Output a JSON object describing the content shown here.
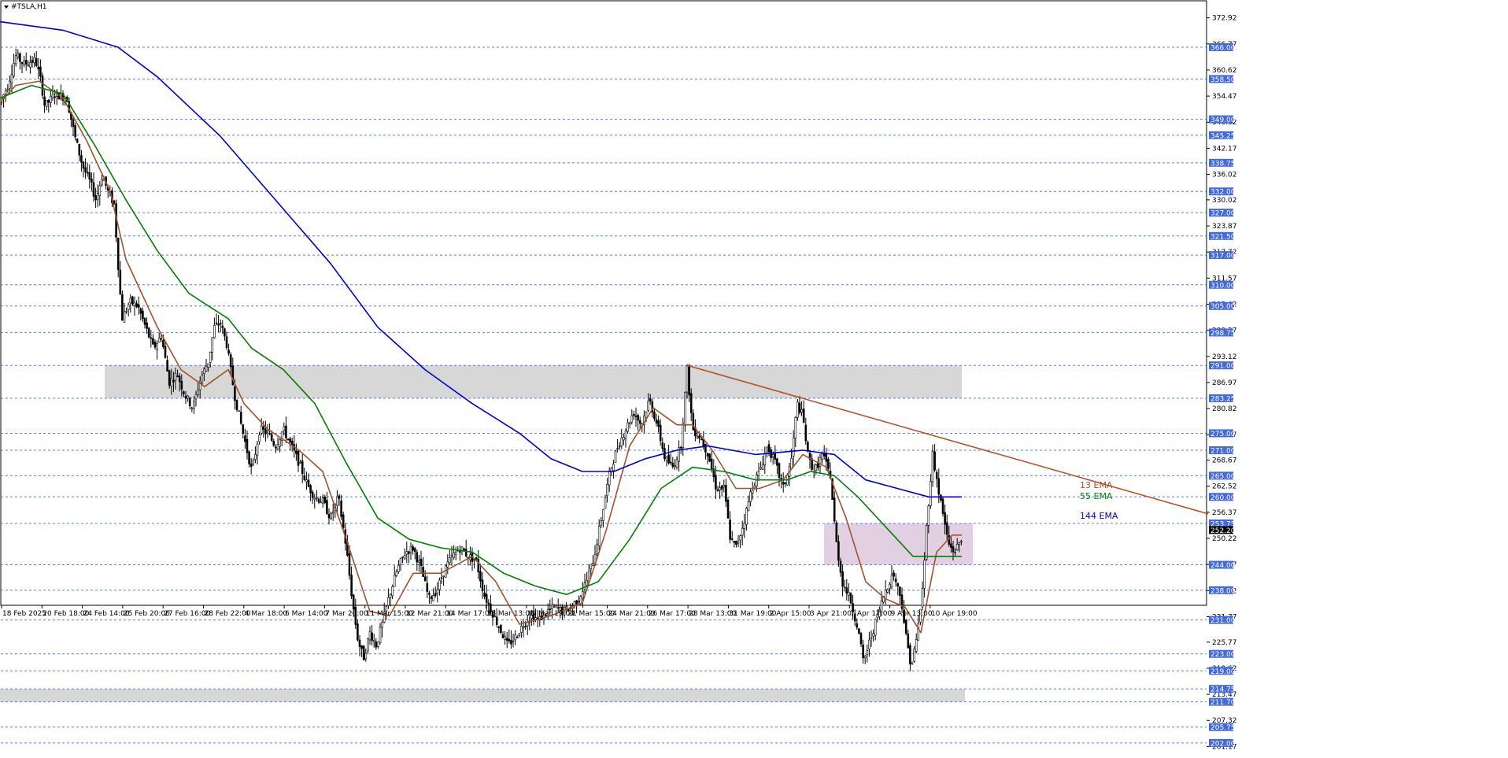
{
  "window": {
    "symbol_title": "#TSLA,H1"
  },
  "colors": {
    "ema13": "#a0522d",
    "ema55": "#008000",
    "ema144": "#0000cd",
    "trendline": "#b5562a",
    "resistance_zone": "#d3d3d3",
    "current_zone": "#d8bfd8",
    "grid_dash": "#4169e1",
    "level_label_bg": "#4169e1",
    "price_label_bg": "#000000",
    "candle": "#000000"
  },
  "chart_data": {
    "type": "candlestick",
    "symbol": "#TSLA",
    "timeframe": "H1",
    "ylim": [
      200.55,
      374.6
    ],
    "y_ticks": [
      "372.92",
      "366.77",
      "360.62",
      "354.47",
      "348.32",
      "342.17",
      "336.02",
      "330.02",
      "323.87",
      "317.72",
      "311.57",
      "305.42",
      "299.27",
      "293.12",
      "286.97",
      "280.82",
      "274.67",
      "268.67",
      "262.52",
      "256.37",
      "250.22",
      "244.07",
      "237.92",
      "231.77",
      "225.77",
      "219.62",
      "213.47",
      "207.32",
      "201.17"
    ],
    "horizontal_levels": [
      366.0,
      358.5,
      349.0,
      345.25,
      338.75,
      332.0,
      327.0,
      321.5,
      317.0,
      310.0,
      305.0,
      298.75,
      291.0,
      283.25,
      275.0,
      271.0,
      265.0,
      260.0,
      253.75,
      244.0,
      238.0,
      231.0,
      223.0,
      219.0,
      214.75,
      211.7,
      205.75,
      202.0
    ],
    "current_price": "252.20",
    "x_axis_labels": [
      "18 Feb 2025",
      "20 Feb 18:00",
      "24 Feb 14:00",
      "25 Feb 20:00",
      "27 Feb 16:00",
      "28 Feb 22:00",
      "4 Mar 18:00",
      "6 Mar 14:00",
      "7 Mar 20:00",
      "11 Mar 15:00",
      "12 Mar 21:00",
      "14 Mar 17:00",
      "18 Mar 13:00",
      "19 Mar 19:00",
      "21 Mar 15:00",
      "24 Mar 21:00",
      "26 Mar 17:00",
      "28 Mar 13:00",
      "31 Mar 19:00",
      "2 Apr 15:00",
      "3 Apr 21:00",
      "7 Apr 17:00",
      "9 Apr 13:00",
      "10 Apr 19:00"
    ],
    "price_path": [
      [
        0,
        353
      ],
      [
        10,
        357
      ],
      [
        20,
        364
      ],
      [
        30,
        362
      ],
      [
        45,
        363
      ],
      [
        52,
        358
      ],
      [
        57,
        352
      ],
      [
        70,
        355
      ],
      [
        85,
        354
      ],
      [
        95,
        345
      ],
      [
        105,
        338
      ],
      [
        115,
        334
      ],
      [
        122,
        330
      ],
      [
        130,
        336
      ],
      [
        137,
        332
      ],
      [
        145,
        329
      ],
      [
        150,
        315
      ],
      [
        155,
        302
      ],
      [
        165,
        306
      ],
      [
        175,
        305
      ],
      [
        185,
        300
      ],
      [
        195,
        295
      ],
      [
        205,
        298
      ],
      [
        215,
        287
      ],
      [
        225,
        289
      ],
      [
        235,
        284
      ],
      [
        245,
        281
      ],
      [
        255,
        288
      ],
      [
        265,
        292
      ],
      [
        272,
        300
      ],
      [
        280,
        301
      ],
      [
        288,
        296
      ],
      [
        298,
        284
      ],
      [
        310,
        274
      ],
      [
        320,
        266
      ],
      [
        330,
        276
      ],
      [
        340,
        275
      ],
      [
        350,
        272
      ],
      [
        360,
        276
      ],
      [
        370,
        272
      ],
      [
        380,
        268
      ],
      [
        390,
        263
      ],
      [
        400,
        260
      ],
      [
        410,
        259
      ],
      [
        420,
        255
      ],
      [
        430,
        260
      ],
      [
        440,
        248
      ],
      [
        448,
        235
      ],
      [
        455,
        226
      ],
      [
        462,
        222
      ],
      [
        470,
        228
      ],
      [
        478,
        225
      ],
      [
        487,
        231
      ],
      [
        495,
        237
      ],
      [
        505,
        243
      ],
      [
        515,
        247
      ],
      [
        525,
        248
      ],
      [
        535,
        243
      ],
      [
        545,
        236
      ],
      [
        555,
        238
      ],
      [
        565,
        243
      ],
      [
        575,
        246
      ],
      [
        585,
        248
      ],
      [
        595,
        246
      ],
      [
        605,
        245
      ],
      [
        615,
        237
      ],
      [
        625,
        233
      ],
      [
        635,
        229
      ],
      [
        645,
        225
      ],
      [
        655,
        227
      ],
      [
        665,
        230
      ],
      [
        675,
        232
      ],
      [
        685,
        231
      ],
      [
        695,
        233
      ],
      [
        705,
        234
      ],
      [
        715,
        233
      ],
      [
        725,
        234
      ],
      [
        735,
        236
      ],
      [
        745,
        240
      ],
      [
        755,
        246
      ],
      [
        765,
        256
      ],
      [
        775,
        266
      ],
      [
        785,
        272
      ],
      [
        795,
        276
      ],
      [
        805,
        280
      ],
      [
        815,
        277
      ],
      [
        825,
        283
      ],
      [
        835,
        277
      ],
      [
        845,
        269
      ],
      [
        855,
        267
      ],
      [
        865,
        272
      ],
      [
        873,
        290
      ],
      [
        880,
        276
      ],
      [
        890,
        274
      ],
      [
        900,
        270
      ],
      [
        910,
        262
      ],
      [
        920,
        262
      ],
      [
        928,
        250
      ],
      [
        935,
        248
      ],
      [
        945,
        254
      ],
      [
        955,
        262
      ],
      [
        965,
        266
      ],
      [
        975,
        272
      ],
      [
        985,
        268
      ],
      [
        995,
        262
      ],
      [
        1005,
        268
      ],
      [
        1013,
        282
      ],
      [
        1020,
        279
      ],
      [
        1027,
        269
      ],
      [
        1035,
        266
      ],
      [
        1045,
        270
      ],
      [
        1055,
        265
      ],
      [
        1062,
        250
      ],
      [
        1070,
        240
      ],
      [
        1080,
        236
      ],
      [
        1090,
        229
      ],
      [
        1097,
        221
      ],
      [
        1105,
        226
      ],
      [
        1115,
        232
      ],
      [
        1125,
        238
      ],
      [
        1135,
        242
      ],
      [
        1145,
        236
      ],
      [
        1152,
        226
      ],
      [
        1158,
        220
      ],
      [
        1165,
        227
      ],
      [
        1172,
        238
      ],
      [
        1178,
        255
      ],
      [
        1185,
        270
      ],
      [
        1192,
        262
      ],
      [
        1198,
        256
      ],
      [
        1205,
        249
      ],
      [
        1212,
        247
      ],
      [
        1222,
        250
      ]
    ],
    "series": [
      {
        "name": "13 EMA",
        "points": [
          [
            0,
            353
          ],
          [
            20,
            357
          ],
          [
            50,
            358
          ],
          [
            80,
            354
          ],
          [
            110,
            344
          ],
          [
            140,
            332
          ],
          [
            160,
            316
          ],
          [
            200,
            300
          ],
          [
            230,
            290
          ],
          [
            260,
            286
          ],
          [
            290,
            290
          ],
          [
            310,
            282
          ],
          [
            340,
            276
          ],
          [
            380,
            271
          ],
          [
            410,
            266
          ],
          [
            440,
            250
          ],
          [
            470,
            233
          ],
          [
            495,
            232
          ],
          [
            525,
            242
          ],
          [
            560,
            242
          ],
          [
            600,
            246
          ],
          [
            630,
            240
          ],
          [
            660,
            230
          ],
          [
            700,
            232
          ],
          [
            740,
            235
          ],
          [
            770,
            252
          ],
          [
            800,
            272
          ],
          [
            830,
            281
          ],
          [
            860,
            277
          ],
          [
            880,
            277
          ],
          [
            905,
            271
          ],
          [
            935,
            262
          ],
          [
            965,
            262
          ],
          [
            995,
            264
          ],
          [
            1020,
            270
          ],
          [
            1050,
            267
          ],
          [
            1075,
            255
          ],
          [
            1100,
            240
          ],
          [
            1125,
            236
          ],
          [
            1150,
            234
          ],
          [
            1170,
            228
          ],
          [
            1190,
            247
          ],
          [
            1210,
            251
          ],
          [
            1222,
            251
          ]
        ]
      },
      {
        "name": "55 EMA",
        "points": [
          [
            0,
            354
          ],
          [
            40,
            357
          ],
          [
            80,
            355
          ],
          [
            120,
            343
          ],
          [
            160,
            330
          ],
          [
            200,
            318
          ],
          [
            240,
            308
          ],
          [
            290,
            302
          ],
          [
            320,
            295
          ],
          [
            360,
            290
          ],
          [
            400,
            282
          ],
          [
            440,
            268
          ],
          [
            480,
            255
          ],
          [
            520,
            250
          ],
          [
            560,
            248
          ],
          [
            600,
            247
          ],
          [
            640,
            242
          ],
          [
            680,
            239
          ],
          [
            720,
            237
          ],
          [
            760,
            240
          ],
          [
            800,
            250
          ],
          [
            840,
            262
          ],
          [
            880,
            267
          ],
          [
            920,
            266
          ],
          [
            960,
            264
          ],
          [
            1000,
            264
          ],
          [
            1030,
            266
          ],
          [
            1060,
            265
          ],
          [
            1090,
            260
          ],
          [
            1130,
            252
          ],
          [
            1160,
            246
          ],
          [
            1180,
            246
          ],
          [
            1210,
            246
          ],
          [
            1222,
            246
          ]
        ]
      },
      {
        "name": "144 EMA",
        "points": [
          [
            0,
            372
          ],
          [
            80,
            370
          ],
          [
            150,
            366
          ],
          [
            200,
            359
          ],
          [
            280,
            345
          ],
          [
            350,
            330
          ],
          [
            420,
            315
          ],
          [
            480,
            300
          ],
          [
            540,
            290
          ],
          [
            600,
            282
          ],
          [
            660,
            275
          ],
          [
            700,
            269
          ],
          [
            740,
            266
          ],
          [
            780,
            266
          ],
          [
            820,
            269
          ],
          [
            860,
            271
          ],
          [
            900,
            272
          ],
          [
            960,
            270
          ],
          [
            1020,
            271
          ],
          [
            1060,
            270
          ],
          [
            1100,
            264
          ],
          [
            1140,
            262
          ],
          [
            1180,
            260
          ],
          [
            1200,
            260
          ],
          [
            1222,
            260
          ]
        ]
      }
    ],
    "trendline": {
      "from": [
        873,
        291
      ],
      "to": [
        1535,
        256
      ]
    },
    "zones": [
      {
        "x": [
          133,
          1222
        ],
        "y": [
          283.25,
          291.0
        ]
      },
      {
        "x": [
          1047,
          1236
        ],
        "y": [
          244.0,
          253.75
        ]
      },
      {
        "x": [
          0,
          1226
        ],
        "y": [
          211.7,
          214.75
        ]
      }
    ],
    "legend": [
      "13 EMA",
      "55 EMA",
      "144 EMA"
    ]
  }
}
